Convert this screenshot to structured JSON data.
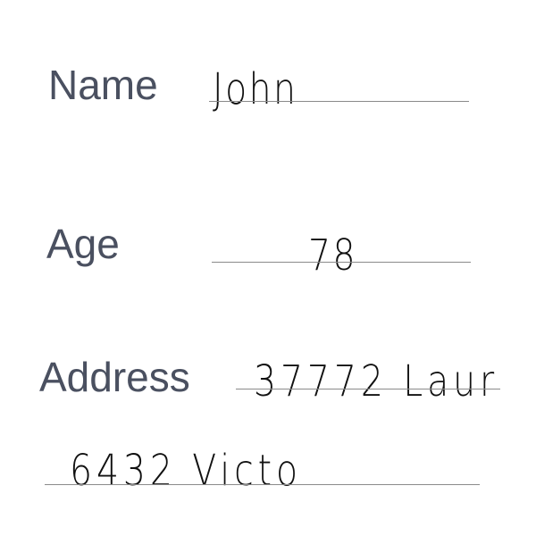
{
  "form": {
    "name": {
      "label": "Name",
      "value": "John"
    },
    "age": {
      "label": "Age",
      "value": "78"
    },
    "address": {
      "label": "Address",
      "line1": "37772 Laur",
      "line2": "6432 Victo"
    }
  },
  "colors": {
    "label_text": "#4a5060",
    "handwriting": "#111111",
    "rule_line": "#8a8a8a"
  }
}
